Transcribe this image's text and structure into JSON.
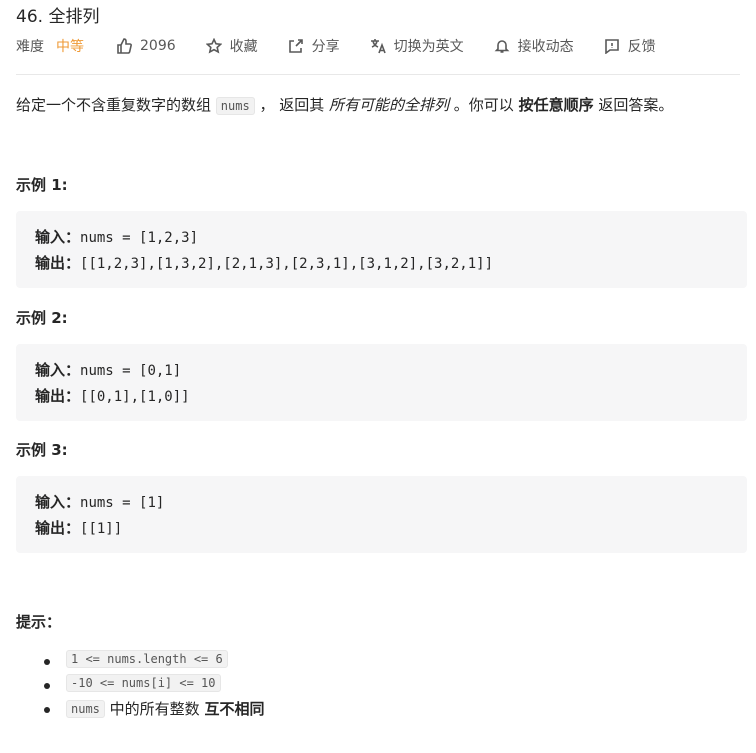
{
  "problem": {
    "title": "46. 全排列"
  },
  "meta": {
    "difficulty_label": "难度",
    "difficulty": "中等",
    "likes": "2096",
    "favorite": "收藏",
    "share": "分享",
    "translate": "切换为英文",
    "notify": "接收动态",
    "feedback": "反馈"
  },
  "description": {
    "p1": "给定一个不含重复数字的数组 ",
    "code": "nums",
    "p2": " ， 返回其 ",
    "italic": "所有可能的全排列",
    "p3": " 。你可以 ",
    "bold": "按任意顺序",
    "p4": " 返回答案。"
  },
  "examples": [
    {
      "heading": "示例 1:",
      "in_label": "输入：",
      "input": "nums = [1,2,3]",
      "out_label": "输出：",
      "output": "[[1,2,3],[1,3,2],[2,1,3],[2,3,1],[3,1,2],[3,2,1]]"
    },
    {
      "heading": "示例 2:",
      "in_label": "输入：",
      "input": "nums = [0,1]",
      "out_label": "输出：",
      "output": "[[0,1],[1,0]]"
    },
    {
      "heading": "示例 3:",
      "in_label": "输入：",
      "input": "nums = [1]",
      "out_label": "输出：",
      "output": "[[1]]"
    }
  ],
  "hints": {
    "heading": "提示：",
    "c1": "1 <= nums.length <= 6",
    "c2": "-10 <= nums[i] <= 10",
    "c3_code": "nums",
    "c3_text": " 中的所有整数 ",
    "c3_bold": "互不相同"
  },
  "colors": {
    "difficulty": "#ef9a36",
    "code_bg": "#f6f6f7"
  }
}
